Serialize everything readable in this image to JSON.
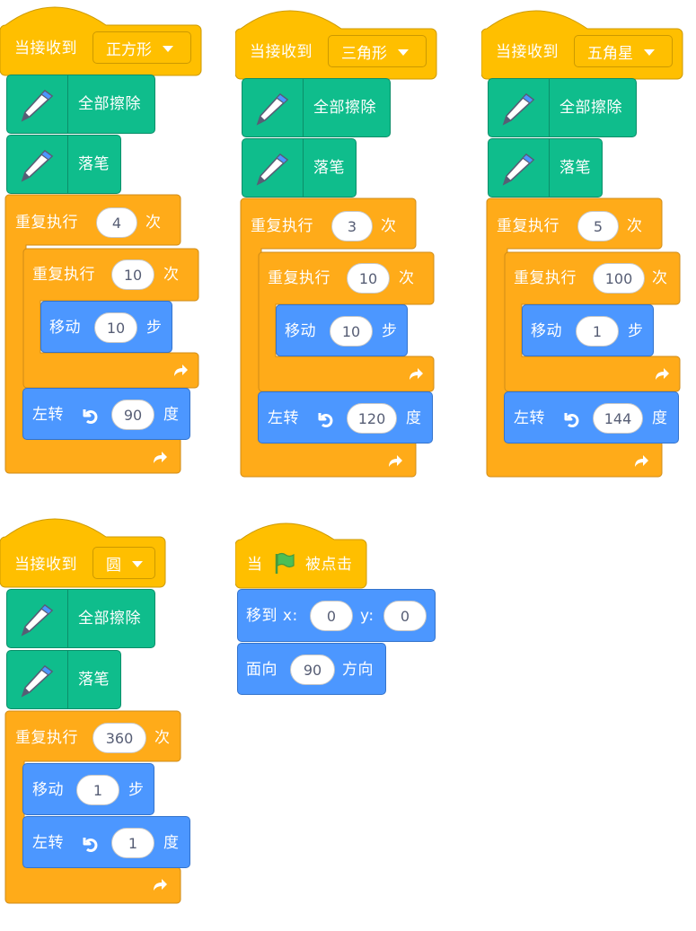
{
  "scripts": [
    {
      "hat_label": "当接收到",
      "message": "正方形",
      "pen_clear_label": "全部擦除",
      "pen_down_label": "落笔",
      "outer_repeat": {
        "label": "重复执行",
        "times": "4",
        "suffix": "次"
      },
      "inner_repeat": {
        "label": "重复执行",
        "times": "10",
        "suffix": "次"
      },
      "move": {
        "label": "移动",
        "steps": "10",
        "suffix": "步"
      },
      "turn": {
        "label": "左转",
        "degrees": "90",
        "suffix": "度"
      }
    },
    {
      "hat_label": "当接收到",
      "message": "三角形",
      "pen_clear_label": "全部擦除",
      "pen_down_label": "落笔",
      "outer_repeat": {
        "label": "重复执行",
        "times": "3",
        "suffix": "次"
      },
      "inner_repeat": {
        "label": "重复执行",
        "times": "10",
        "suffix": "次"
      },
      "move": {
        "label": "移动",
        "steps": "10",
        "suffix": "步"
      },
      "turn": {
        "label": "左转",
        "degrees": "120",
        "suffix": "度"
      }
    },
    {
      "hat_label": "当接收到",
      "message": "五角星",
      "pen_clear_label": "全部擦除",
      "pen_down_label": "落笔",
      "outer_repeat": {
        "label": "重复执行",
        "times": "5",
        "suffix": "次"
      },
      "inner_repeat": {
        "label": "重复执行",
        "times": "100",
        "suffix": "次"
      },
      "move": {
        "label": "移动",
        "steps": "1",
        "suffix": "步"
      },
      "turn": {
        "label": "左转",
        "degrees": "144",
        "suffix": "度"
      }
    },
    {
      "hat_label": "当接收到",
      "message": "圆",
      "pen_clear_label": "全部擦除",
      "pen_down_label": "落笔",
      "outer_repeat": {
        "label": "重复执行",
        "times": "360",
        "suffix": "次"
      },
      "move": {
        "label": "移动",
        "steps": "1",
        "suffix": "步"
      },
      "turn": {
        "label": "左转",
        "degrees": "1",
        "suffix": "度"
      }
    }
  ],
  "flag_script": {
    "hat_prefix": "当",
    "hat_suffix": "被点击",
    "goto": {
      "label": "移到 x:",
      "x": "0",
      "y_label": "y:",
      "y": "0"
    },
    "point": {
      "label": "面向",
      "direction": "90",
      "suffix": "方向"
    }
  },
  "colors": {
    "events": "#ffbf00",
    "events_border": "#cc9900",
    "control": "#ffab19",
    "control_border": "#cf8b17",
    "motion": "#4c97ff",
    "motion_border": "#3373cc",
    "pen": "#0fbd8c",
    "pen_border": "#0b8e69",
    "flag": "#4cbf56"
  },
  "icons": {
    "pen": "pen-icon",
    "turn": "rotate-left-icon",
    "loop": "loop-arrow-icon",
    "flag": "green-flag-icon",
    "dropdown": "dropdown-arrow-icon"
  }
}
